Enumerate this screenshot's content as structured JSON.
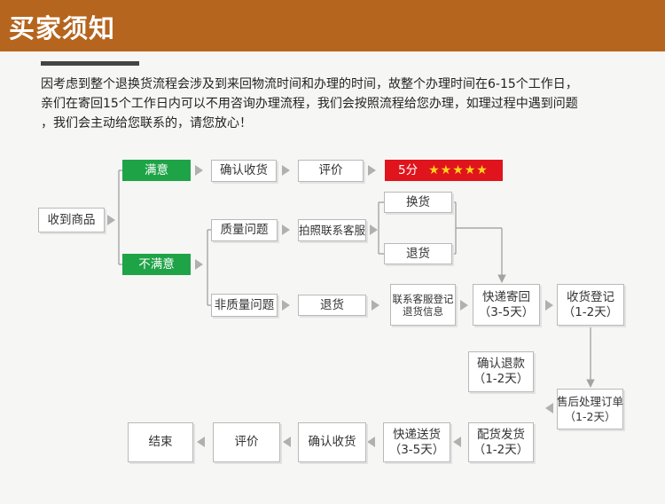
{
  "header": {
    "title": "买家须知"
  },
  "intro": {
    "lines": [
      "因考虑到整个退换货流程会涉及到来回物流时间和办理的时间，故整个办理时间在6-15个工作日，",
      "亲们在寄回15个工作日内可以不用咨询办理流程，我们会按照流程给您办理，如理过程中遇到问题",
      "，我们会主动给您联系的，请您放心！"
    ]
  },
  "colors": {
    "header": "#b5651d",
    "satisfied": "#1fa347",
    "rating": "#e0141c",
    "star": "#ffd21a"
  },
  "nodes": {
    "receive": [
      "收到商品"
    ],
    "satisfied": [
      "满意"
    ],
    "confirm_receipt_1": [
      "确认收货"
    ],
    "review_1": [
      "评价"
    ],
    "rating": {
      "score": "5分",
      "stars": "★★★★★"
    },
    "unsatisfied": [
      "不满意"
    ],
    "quality_issue": [
      "质量问题"
    ],
    "photo_contact": [
      "拍照联系客服"
    ],
    "exchange": [
      "换货"
    ],
    "return_goods_1": [
      "退货"
    ],
    "non_quality_issue": [
      "非质量问题"
    ],
    "return_goods_2": [
      "退货"
    ],
    "register_return": [
      "联系客服登记",
      "退货信息"
    ],
    "express_return": [
      "快递寄回",
      "（3-5天）"
    ],
    "receipt_register": [
      "收货登记",
      "（1-2天）"
    ],
    "after_sales": [
      "售后处理订单",
      "（1-2天）"
    ],
    "confirm_refund": [
      "确认退款",
      "（1-2天）"
    ],
    "ship_goods": [
      "配货发货",
      "（1-2天）"
    ],
    "express_delivery": [
      "快递送货",
      "（3-5天）"
    ],
    "confirm_receipt_2": [
      "确认收货"
    ],
    "review_2": [
      "评价"
    ],
    "end": [
      "结束"
    ]
  }
}
